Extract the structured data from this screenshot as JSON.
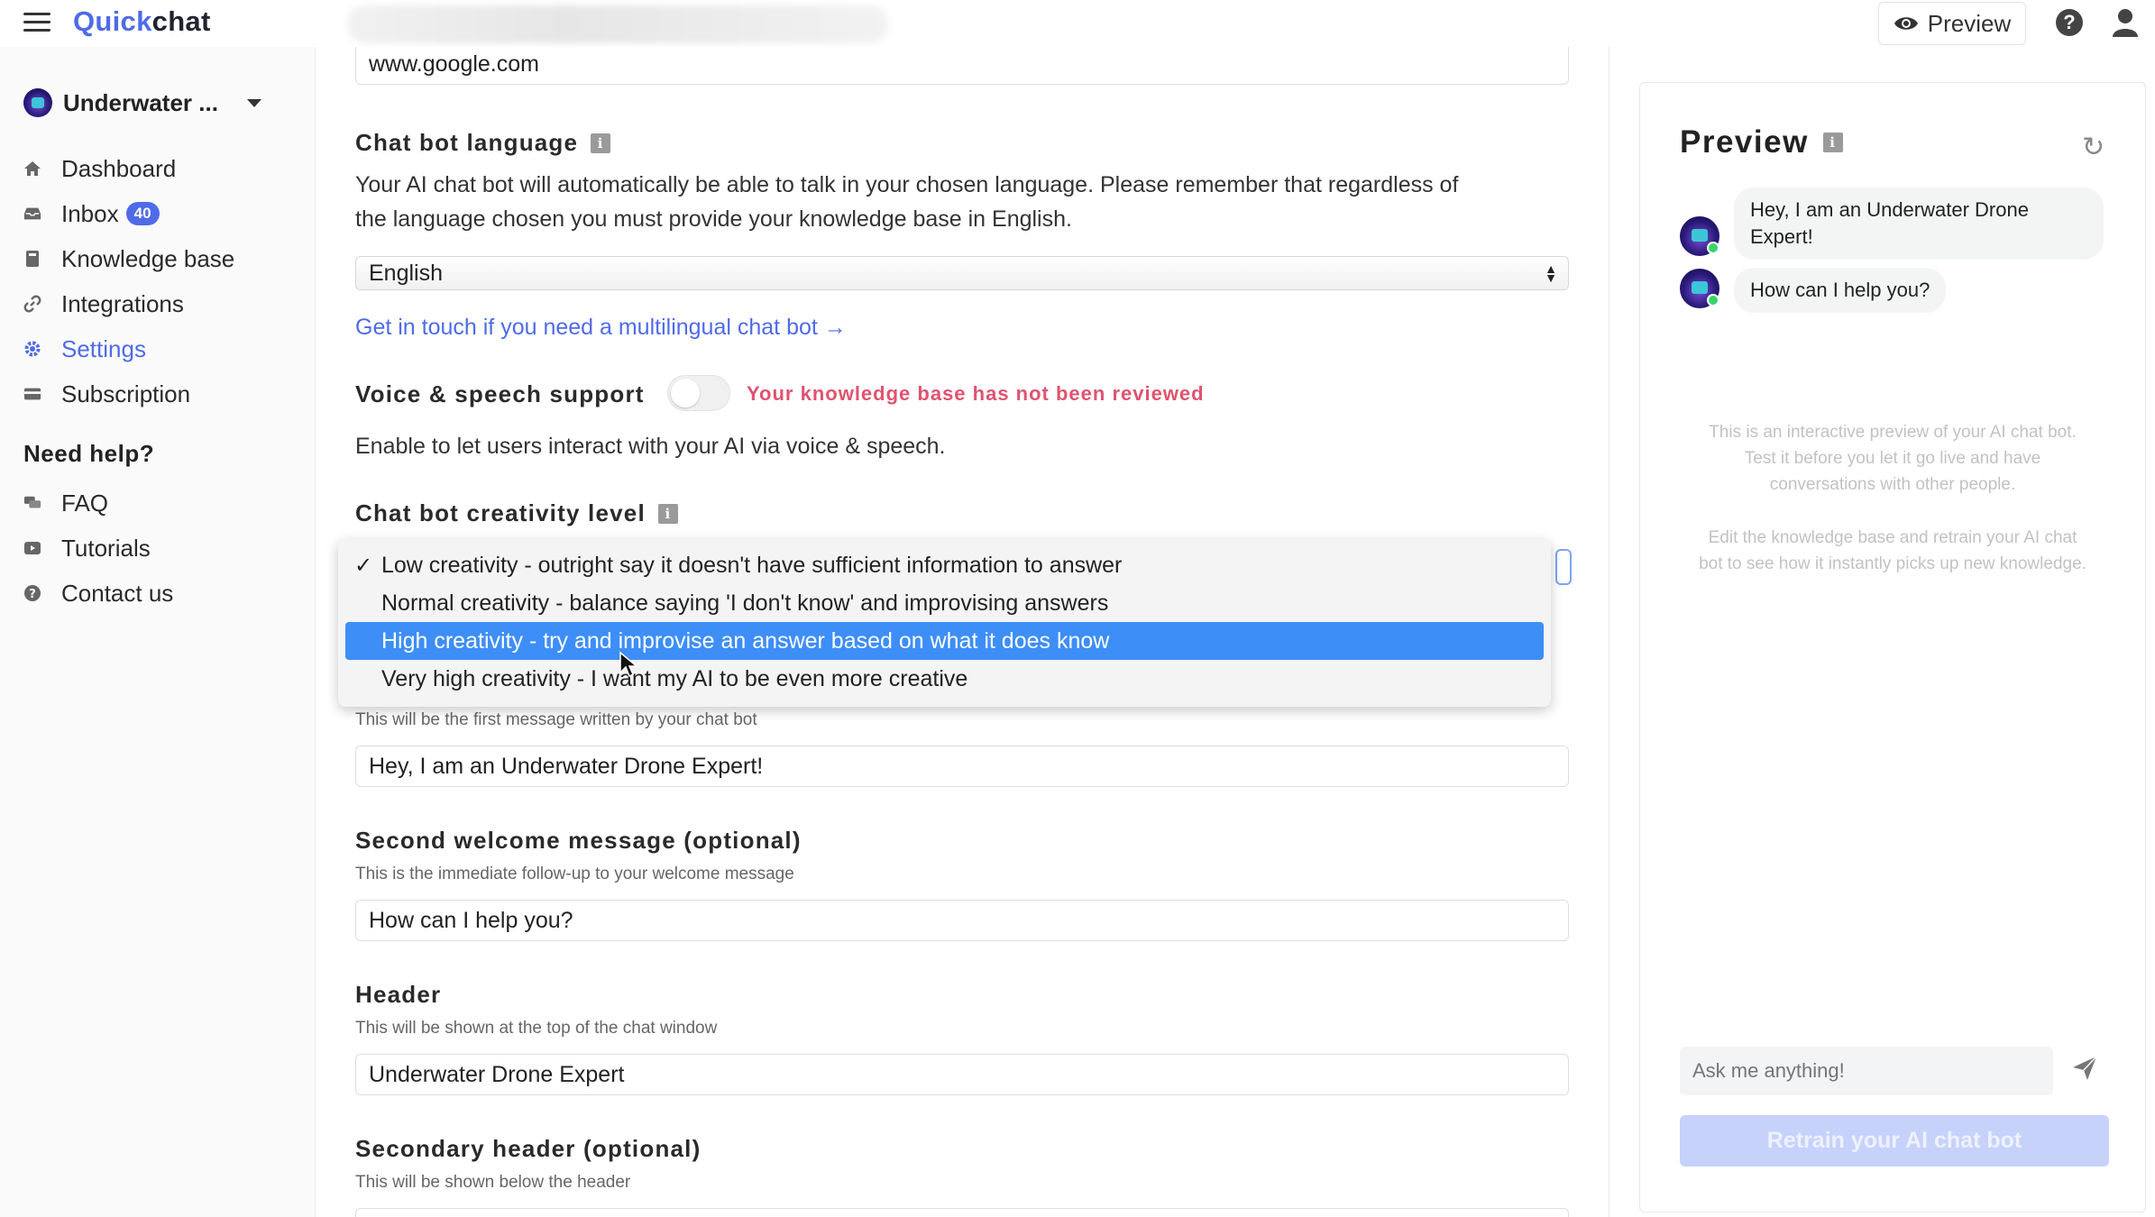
{
  "brand": {
    "part1": "Quick",
    "part2": "chat"
  },
  "topbar": {
    "preview_label": "Preview"
  },
  "workspace": {
    "name": "Underwater ..."
  },
  "nav": {
    "dashboard": "Dashboard",
    "inbox": "Inbox",
    "inbox_count": "40",
    "knowledge_base": "Knowledge base",
    "integrations": "Integrations",
    "settings": "Settings",
    "subscription": "Subscription"
  },
  "help": {
    "heading": "Need help?",
    "faq": "FAQ",
    "tutorials": "Tutorials",
    "contact": "Contact us"
  },
  "main": {
    "website_value": "www.google.com",
    "language_title": "Chat bot language",
    "language_desc_line1": "Your AI chat bot will automatically be able to talk in your chosen language. Please remember that regardless of",
    "language_desc_line2": "the language chosen you must provide your knowledge base in English.",
    "language_value": "English",
    "multilingual_link": "Get in touch if you need a multilingual chat bot",
    "voice_title": "Voice & speech support",
    "voice_warning": "Your knowledge base has not been reviewed",
    "voice_desc": "Enable to let users interact with your AI via voice & speech.",
    "creativity_title": "Chat bot creativity level",
    "welcome_help": "This will be the first message written by your chat bot",
    "welcome_value": "Hey, I am an Underwater Drone Expert!",
    "second_title": "Second welcome message (optional)",
    "second_help": "This is the immediate follow-up to your welcome message",
    "second_value": "How can I help you?",
    "header_title": "Header",
    "header_help": "This will be shown at the top of the chat window",
    "header_value": "Underwater Drone Expert",
    "secondary_title": "Secondary header (optional)",
    "secondary_help": "This will be shown below the header"
  },
  "creativity_options": [
    {
      "label": "Low creativity - outright say it doesn't have sufficient information to answer",
      "checked": true
    },
    {
      "label": "Normal creativity - balance saying 'I don't know' and improvising answers",
      "checked": false
    },
    {
      "label": "High creativity - try and improvise an answer based on what it does know",
      "highlighted": true
    },
    {
      "label": "Very high creativity - I want my AI to be even more creative",
      "checked": false
    }
  ],
  "preview": {
    "title": "Preview",
    "message1": "Hey, I am an Underwater Drone Expert!",
    "message2": "How can I help you?",
    "info1": "This is an interactive preview of your AI chat bot. Test it before you let it go live and have conversations with other people.",
    "info2": "Edit the knowledge base and retrain your AI chat bot to see how it instantly picks up new knowledge.",
    "input_placeholder": "Ask me anything!",
    "retrain_label": "Retrain your AI chat bot"
  },
  "colors": {
    "accent": "#4f6be8",
    "warning": "#e0536f",
    "dropdown_highlight": "#3d8ef7"
  }
}
